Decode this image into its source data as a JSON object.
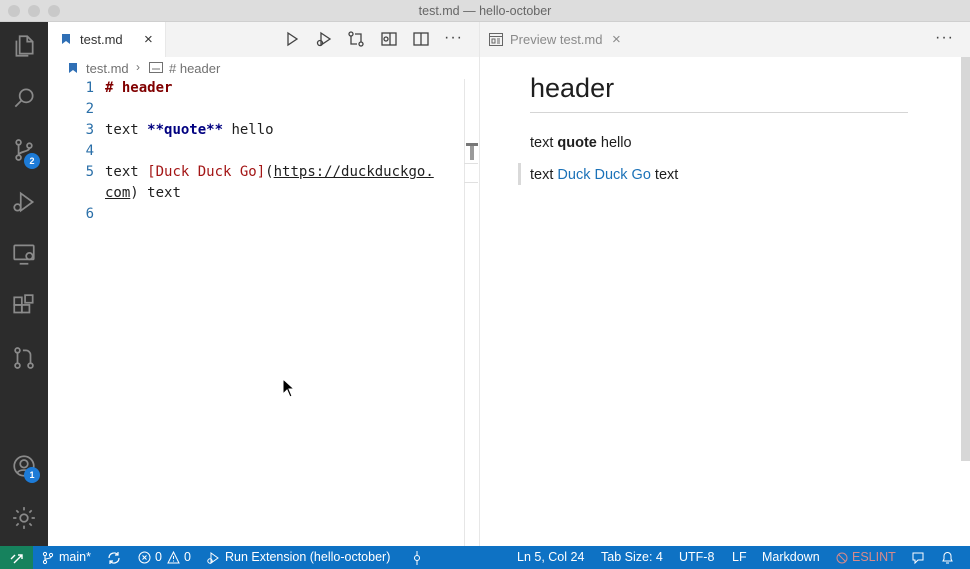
{
  "window": {
    "title": "test.md — hello-october"
  },
  "activity": {
    "scm_badge": "2",
    "accounts_badge": "1"
  },
  "editor": {
    "tab_label": "test.md",
    "tab_close": "×",
    "more": "···",
    "breadcrumb": {
      "file": "test.md",
      "symbol": "# header"
    },
    "lines": [
      {
        "n": "1",
        "parts": [
          {
            "t": "# header",
            "c": "md-h"
          }
        ]
      },
      {
        "n": "2",
        "parts": []
      },
      {
        "n": "3",
        "parts": [
          {
            "t": "text ",
            "c": ""
          },
          {
            "t": "**quote**",
            "c": "md-b"
          },
          {
            "t": " hello",
            "c": ""
          }
        ]
      },
      {
        "n": "4",
        "parts": []
      },
      {
        "n": "5",
        "parts": [
          {
            "t": "text ",
            "c": ""
          },
          {
            "t": "[Duck Duck Go]",
            "c": "md-link"
          },
          {
            "t": "(",
            "c": ""
          },
          {
            "t": "https://duckduckgo.",
            "c": "md-url"
          }
        ]
      },
      {
        "n": "",
        "parts": [
          {
            "t": "com",
            "c": "md-url"
          },
          {
            "t": ") text",
            "c": ""
          }
        ]
      },
      {
        "n": "6",
        "parts": []
      }
    ]
  },
  "preview": {
    "tab_label": "Preview test.md",
    "tab_close": "×",
    "more": "···",
    "heading": "header",
    "p1_before": "text ",
    "p1_bold": "quote",
    "p1_after": " hello",
    "p2_before": "text ",
    "p2_link": "Duck Duck Go",
    "p2_after": " text"
  },
  "status": {
    "branch": "main*",
    "errors": "0",
    "warnings": "0",
    "run": "Run Extension (hello-october)",
    "position": "Ln 5, Col 24",
    "tab_size": "Tab Size: 4",
    "encoding": "UTF-8",
    "eol": "LF",
    "language": "Markdown",
    "eslint": "ESLINT"
  },
  "colors": {
    "activity_bar": "#2c2c2c",
    "status_bar": "#0e72c4",
    "remote": "#16825d",
    "badge": "#1d7bd7",
    "link": "#1b72b8"
  }
}
